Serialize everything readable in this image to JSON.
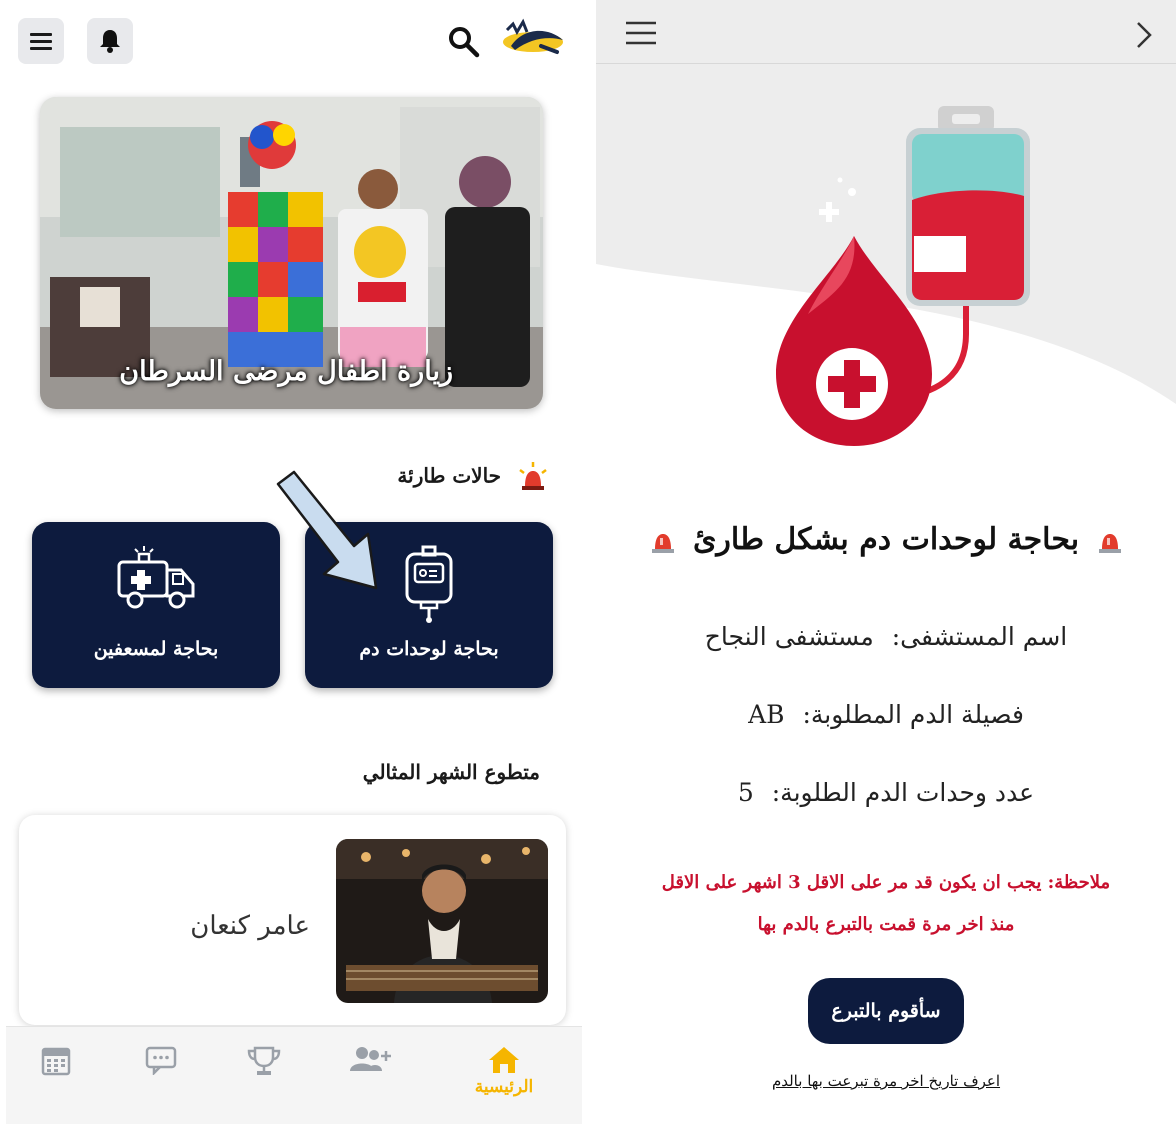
{
  "left_screen": {
    "banner": {
      "caption": "زيارة اطفال مرضى السرطان"
    },
    "emergency": {
      "heading": "حالات طارئة",
      "cards": [
        {
          "label": "بحاجة لوحدات دم",
          "icon": "blood-bag-icon"
        },
        {
          "label": "بحاجة لمسعفين",
          "icon": "ambulance-icon"
        }
      ]
    },
    "volunteer": {
      "heading": "متطوع الشهر المثالي",
      "name": "عامر كنعان"
    },
    "bottom_nav": {
      "items": [
        {
          "label": "الرئيسية",
          "icon": "home-icon",
          "active": true
        },
        {
          "label": "",
          "icon": "add-user-icon"
        },
        {
          "label": "",
          "icon": "trophy-icon"
        },
        {
          "label": "",
          "icon": "chat-icon"
        },
        {
          "label": "",
          "icon": "calendar-icon"
        }
      ],
      "active_color": "#f5b500",
      "inactive_color": "#9aa0a8"
    }
  },
  "right_screen": {
    "title": "بحاجة لوحدات دم بشكل طارئ",
    "details": [
      {
        "label": "اسم المستشفى:",
        "value": "مستشفى النجاح"
      },
      {
        "label": "فصيلة الدم المطلوبة:",
        "value": "AB"
      },
      {
        "label": "عدد وحدات الدم الطلوبة:",
        "value": "5"
      }
    ],
    "note_line1": "ملاحظة: يجب ان يكون قد مر على الاقل 3 اشهر على الاقل",
    "note_line2": "منذ اخر مرة قمت بالتبرع بالدم بها",
    "donate_button": "سأقوم بالتبرع",
    "last_donation_link": "اعرف تاريخ اخر مرة تبرعت بها بالدم"
  },
  "colors": {
    "navy": "#0d1b3e",
    "blood_red": "#c8102e",
    "accent_yellow": "#f5b500"
  }
}
